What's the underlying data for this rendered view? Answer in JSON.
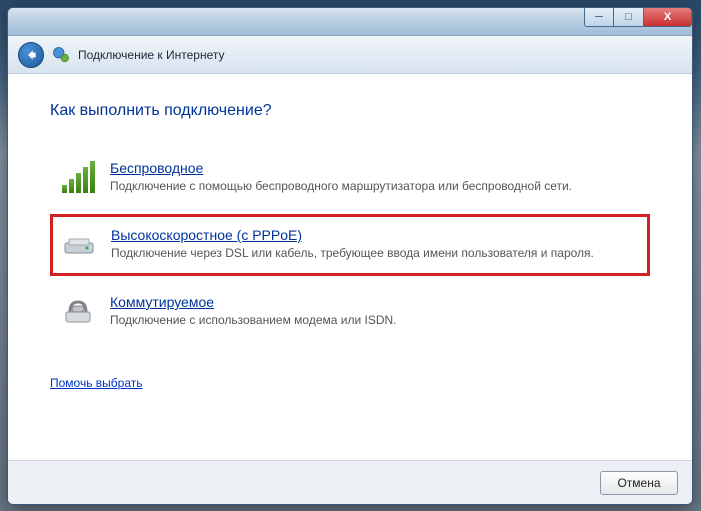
{
  "window": {
    "title": "Подключение к Интернету"
  },
  "heading": "Как выполнить подключение?",
  "options": [
    {
      "title": "Беспроводное",
      "desc": "Подключение с помощью беспроводного маршрутизатора или беспроводной сети."
    },
    {
      "title": "Высокоскоростное (с PPPoE)",
      "desc": "Подключение через DSL или кабель, требующее ввода имени пользователя и пароля."
    },
    {
      "title": "Коммутируемое",
      "desc": "Подключение с использованием модема или ISDN."
    }
  ],
  "help_link": "Помочь выбрать",
  "buttons": {
    "cancel": "Отмена"
  }
}
